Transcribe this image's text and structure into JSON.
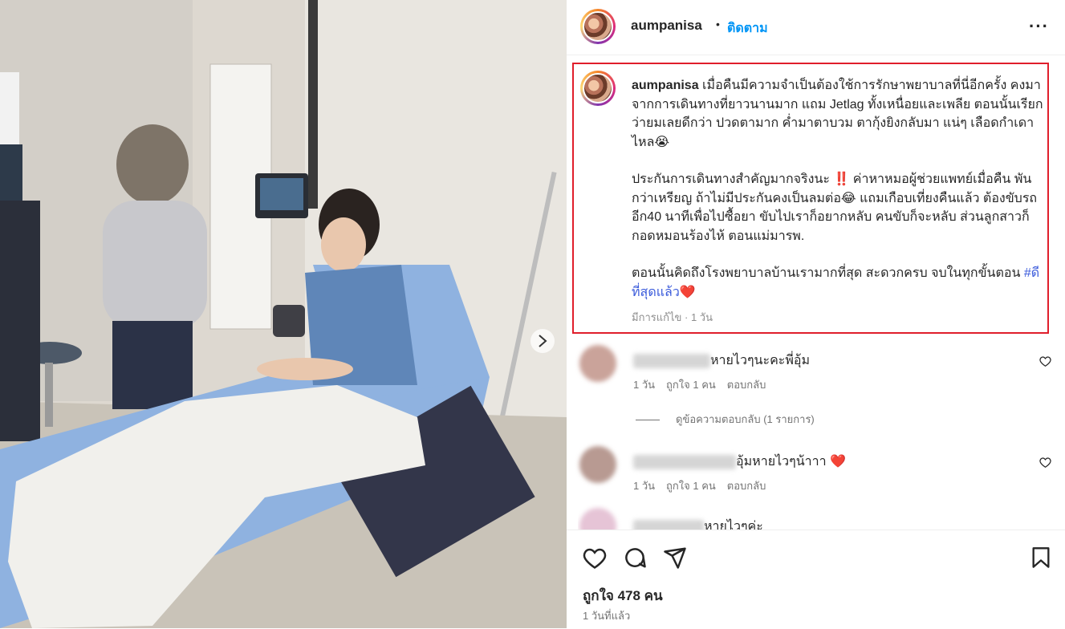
{
  "post": {
    "username": "aumpanisa",
    "dot": "•",
    "follow_label": "ติดตาม",
    "more_label": "···",
    "caption_username": "aumpanisa",
    "caption_p1": "เมื่อคืนมีความจำเป็นต้องใช้การรักษาพยาบาลที่นี่อีกครั้ง คงมาจากการเดินทางที่ยาวนานมาก แถม Jetlag ทั้งเหนื่อยและเพลีย ตอนนั้นเรียกว่ายมเลยดีกว่า ปวดตามาก ค่ำมาตาบวม ตากุ้งยิงกลับมา แน่ๆ เลือดกำเดาไหล😭",
    "caption_p2": "ประกันการเดินทางสำคัญมากจริงนะ ‼️ ค่าหาหมอผู้ช่วยแพทย์เมื่อคืน พันกว่าเหรียญ ถ้าไม่มีประกันคงเป็นลมต่อ😂 แถมเกือบเที่ยงคืนแล้ว ต้องขับรถอีก40 นาทีเพื่อไปซื้อยา ขับไปเราก็อยากหลับ คนขับก็จะหลับ ส่วนลูกสาวก็กอดหมอนร้องไห้ ตอนแม่มารพ.",
    "caption_p3": "ตอนนั้นคิดถึงโรงพยาบาลบ้านเรามากที่สุด สะดวกครบ จบในทุกขั้นตอน",
    "hashtag": "#ดีที่สุดแล้ว",
    "hashtag_emoji": "❤️",
    "caption_meta": "มีการแก้ไข · 1 วัน"
  },
  "comments": [
    {
      "text": "หายไวๆนะคะพี่อุ้ม",
      "time": "1 วัน",
      "likes": "ถูกใจ 1 คน",
      "reply": "ตอบกลับ"
    },
    {
      "text": "อุ้มหายไวๆน้าาา ❤️",
      "time": "1 วัน",
      "likes": "ถูกใจ 1 คน",
      "reply": "ตอบกลับ"
    },
    {
      "text": "หายไวๆค่ะ"
    }
  ],
  "view_replies": "ดูข้อความตอบกลับ (1 รายการ)",
  "footer": {
    "likes": "ถูกใจ 478 คน",
    "time": "1 วันที่แล้ว"
  },
  "colors": {
    "accent": "#0095f6",
    "highlight_border": "#e01e2b",
    "hashtag": "#3b5bdb",
    "bed_blue": "#8fb2e0"
  },
  "icons": [
    "chevron-right-icon",
    "more-icon",
    "heart-icon",
    "comment-icon",
    "share-icon",
    "bookmark-icon"
  ]
}
